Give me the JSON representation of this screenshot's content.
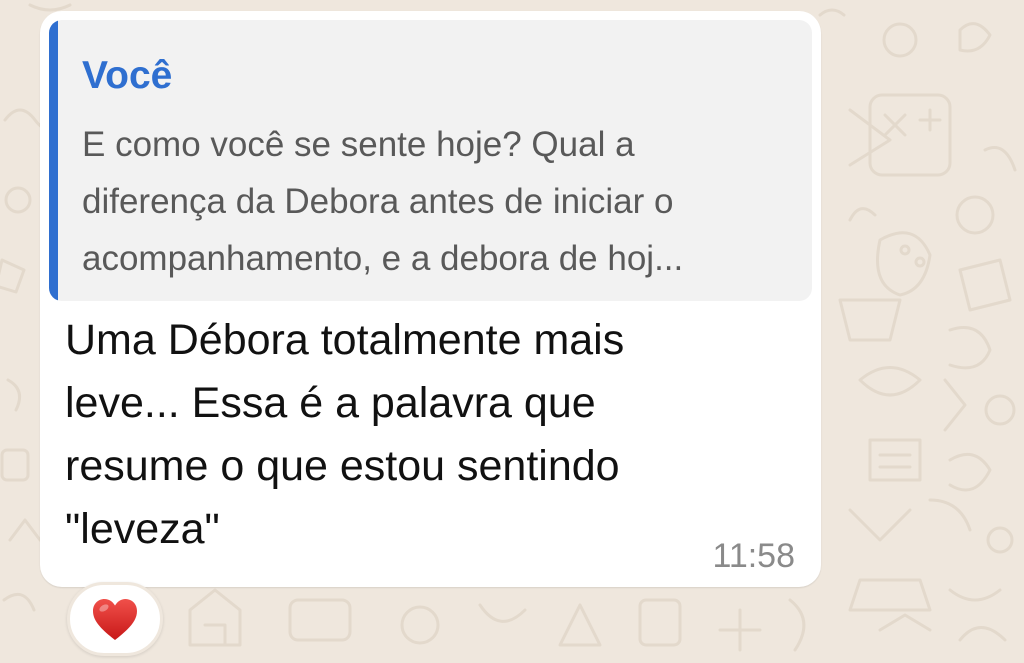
{
  "quoted_message": {
    "author": "Você",
    "text": "E como você se sente hoje? Qual a\ndiferença da Debora antes de iniciar o\nacompanhamento, e a debora de hoj..."
  },
  "message": {
    "text": "Uma Débora totalmente mais\nleve... Essa é a palavra que\nresume o que estou sentindo\n\"leveza\"",
    "time": "11:58"
  },
  "reaction": {
    "emoji": "heart-icon"
  },
  "colors": {
    "chat_background": "#efe7dd",
    "bubble": "#ffffff",
    "quote_accent": "#2f6fd0",
    "heart": "#e02424"
  }
}
